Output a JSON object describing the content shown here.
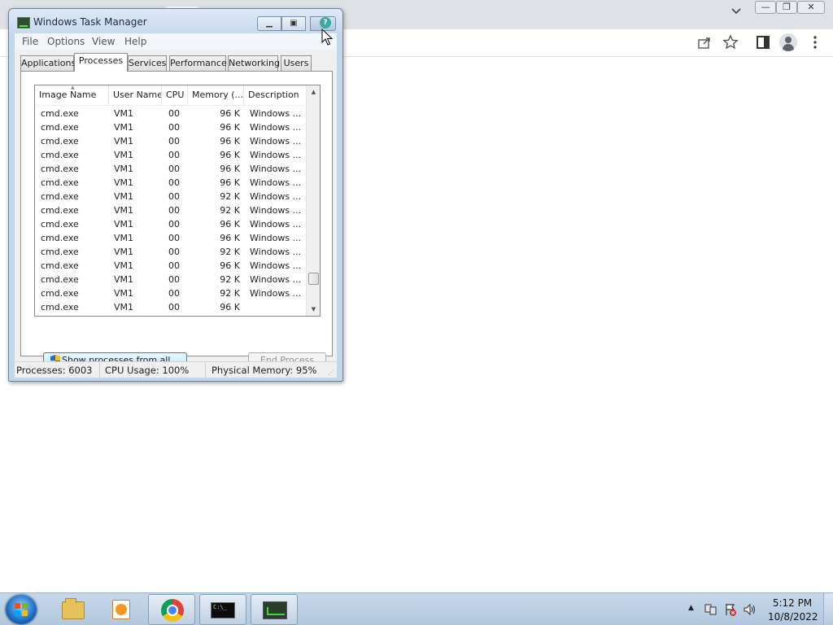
{
  "browser": {
    "window_controls": {
      "minimize": "—",
      "restore": "❐",
      "close": "✕"
    },
    "toolbar_icons": [
      "share-icon",
      "star-icon",
      "side-panel-icon",
      "profile-icon",
      "kebab-menu-icon"
    ]
  },
  "task_manager": {
    "title": "Windows Task Manager",
    "caption": {
      "minimize": "▁",
      "maximize": "▣",
      "close": "✕",
      "help": "?"
    },
    "menu": [
      "File",
      "Options",
      "View",
      "Help"
    ],
    "tabs": [
      "Applications",
      "Processes",
      "Services",
      "Performance",
      "Networking",
      "Users"
    ],
    "active_tab": "Processes",
    "columns": [
      "Image Name",
      "User Name",
      "CPU",
      "Memory (...",
      "Description"
    ],
    "rows": [
      {
        "image": "cmd.exe",
        "user": "VM1",
        "cpu": "00",
        "mem": "96 K",
        "desc": "Windows ..."
      },
      {
        "image": "cmd.exe",
        "user": "VM1",
        "cpu": "00",
        "mem": "96 K",
        "desc": "Windows ..."
      },
      {
        "image": "cmd.exe",
        "user": "VM1",
        "cpu": "00",
        "mem": "96 K",
        "desc": "Windows ..."
      },
      {
        "image": "cmd.exe",
        "user": "VM1",
        "cpu": "00",
        "mem": "96 K",
        "desc": "Windows ..."
      },
      {
        "image": "cmd.exe",
        "user": "VM1",
        "cpu": "00",
        "mem": "96 K",
        "desc": "Windows ..."
      },
      {
        "image": "cmd.exe",
        "user": "VM1",
        "cpu": "00",
        "mem": "96 K",
        "desc": "Windows ..."
      },
      {
        "image": "cmd.exe",
        "user": "VM1",
        "cpu": "00",
        "mem": "92 K",
        "desc": "Windows ..."
      },
      {
        "image": "cmd.exe",
        "user": "VM1",
        "cpu": "00",
        "mem": "92 K",
        "desc": "Windows ..."
      },
      {
        "image": "cmd.exe",
        "user": "VM1",
        "cpu": "00",
        "mem": "96 K",
        "desc": "Windows ..."
      },
      {
        "image": "cmd.exe",
        "user": "VM1",
        "cpu": "00",
        "mem": "96 K",
        "desc": "Windows ..."
      },
      {
        "image": "cmd.exe",
        "user": "VM1",
        "cpu": "00",
        "mem": "92 K",
        "desc": "Windows ..."
      },
      {
        "image": "cmd.exe",
        "user": "VM1",
        "cpu": "00",
        "mem": "96 K",
        "desc": "Windows ..."
      },
      {
        "image": "cmd.exe",
        "user": "VM1",
        "cpu": "00",
        "mem": "92 K",
        "desc": "Windows ..."
      },
      {
        "image": "cmd.exe",
        "user": "VM1",
        "cpu": "00",
        "mem": "92 K",
        "desc": "Windows ..."
      },
      {
        "image": "cmd.exe",
        "user": "VM1",
        "cpu": "00",
        "mem": "96 K",
        "desc": ""
      }
    ],
    "buttons": {
      "show_all": "Show processes from all users",
      "end_process": "End Process"
    },
    "status": {
      "processes": "Processes: 6003",
      "cpu": "CPU Usage: 100%",
      "memory": "Physical Memory: 95%"
    }
  },
  "taskbar": {
    "pinned": [
      "windows-explorer",
      "media-player",
      "google-chrome",
      "command-prompt",
      "task-manager"
    ],
    "cmd_icon_text": "C:\\_",
    "tray_expand": "▲",
    "clock": {
      "time": "5:12 PM",
      "date": "10/8/2022"
    }
  }
}
